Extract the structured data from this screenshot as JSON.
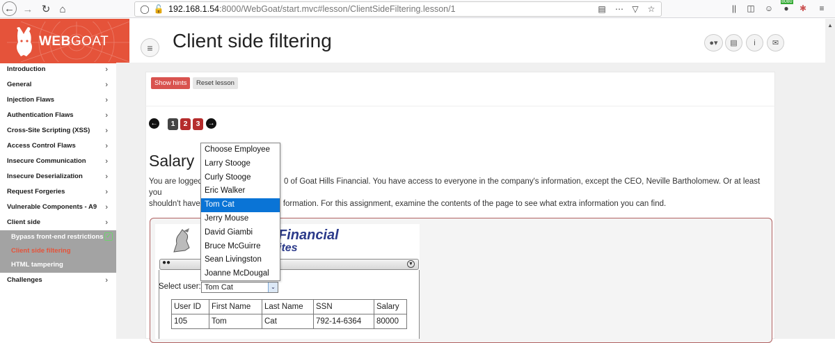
{
  "browser": {
    "url_host": "192.168.1.54",
    "url_rest": ":8000/WebGoat/start.mvc#lesson/ClientSideFiltering.lesson/1",
    "extension_badge": "8080"
  },
  "brand": {
    "logo_bold": "WEB",
    "logo_thin": "GOAT",
    "accent_color": "#e5533a"
  },
  "sidebar": {
    "items": [
      {
        "label": "Introduction"
      },
      {
        "label": "General"
      },
      {
        "label": "Injection Flaws"
      },
      {
        "label": "Authentication Flaws"
      },
      {
        "label": "Cross-Site Scripting (XSS)"
      },
      {
        "label": "Access Control Flaws"
      },
      {
        "label": "Insecure Communication"
      },
      {
        "label": "Insecure Deserialization"
      },
      {
        "label": "Request Forgeries"
      },
      {
        "label": "Vulnerable Components - A9"
      },
      {
        "label": "Client side"
      }
    ],
    "sub_items": [
      {
        "label": "Bypass front-end restrictions",
        "completed": true
      },
      {
        "label": "Client side filtering",
        "active": true
      },
      {
        "label": "HTML tampering"
      }
    ],
    "last_item": {
      "label": "Challenges"
    }
  },
  "header": {
    "title": "Client side filtering"
  },
  "lesson": {
    "show_hints": "Show hints",
    "reset_lesson": "Reset lesson",
    "pages": [
      "1",
      "2",
      "3"
    ],
    "heading": "Salary",
    "text_line1_a": "You are logged",
    "text_line1_b": "0 of Goat Hills Financial. You have access to everyone in the company's information, except the CEO, Neville Bartholomew. Or at least you",
    "text_line2_a": "shouldn't have",
    "text_line2_b": "formation. For this assignment, examine the contents of the page to see what extra information you can find."
  },
  "app": {
    "brand_financial": "Financial",
    "brand_ites": "ites",
    "select_label": "Select user:",
    "selected_user": "Tom Cat",
    "table_headers": [
      "User ID",
      "First Name",
      "Last Name",
      "SSN",
      "Salary"
    ],
    "table_rows": [
      [
        "105",
        "Tom",
        "Cat",
        "792-14-6364",
        "80000"
      ]
    ],
    "employee_options": [
      "Choose Employee",
      "Larry Stooge",
      "Curly Stooge",
      "Eric Walker",
      "Tom Cat",
      "Jerry Mouse",
      "David Giambi",
      "Bruce McGuirre",
      "Sean Livingston",
      "Joanne McDougal"
    ]
  }
}
